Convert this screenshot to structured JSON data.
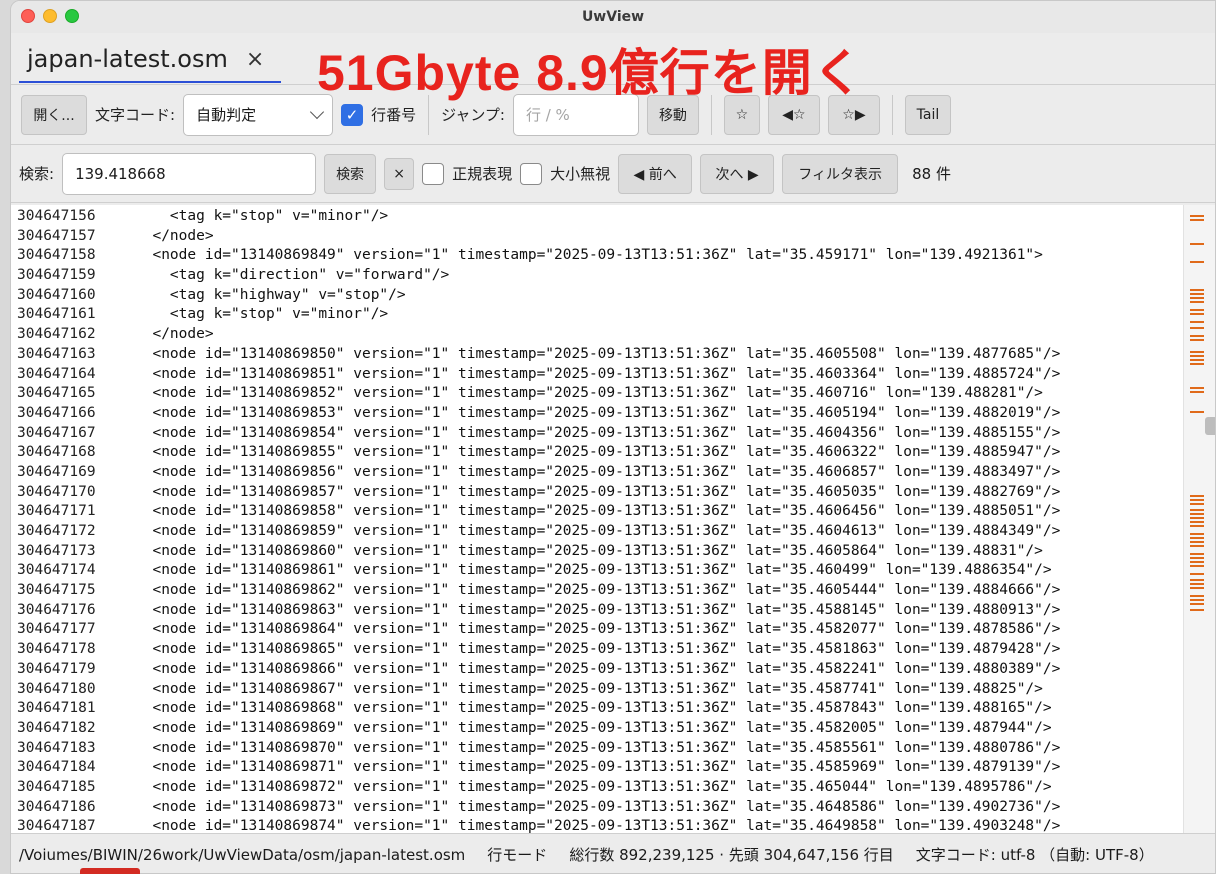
{
  "window": {
    "title": "UwView"
  },
  "tab": {
    "label": "japan-latest.osm",
    "close": "×"
  },
  "banner": "51Gbyte 8.9億行を開く",
  "toolbar": {
    "open_label": "開く...",
    "encoding_label": "文字コード:",
    "encoding_value": "自動判定",
    "line_numbers_label": "行番号",
    "line_numbers_checked": true,
    "jump_label": "ジャンプ:",
    "jump_placeholder": "行 / %",
    "move_label": "移動",
    "star_label": "☆",
    "prev_star_label": "◀☆",
    "next_star_label": "☆▶",
    "tail_label": "Tail"
  },
  "search": {
    "label": "検索:",
    "value": "139.418668",
    "search_button": "検索",
    "clear_button": "×",
    "regex_label": "正規表現",
    "regex_checked": false,
    "ignore_case_label": "大小無視",
    "ignore_case_checked": false,
    "prev_label": "◀ 前へ",
    "next_label": "次へ ▶",
    "filter_label": "フィルタ表示",
    "result_count": "88 件"
  },
  "lines": [
    {
      "no": "304647156",
      "text": "    <tag k=\"stop\" v=\"minor\"/>"
    },
    {
      "no": "304647157",
      "text": "  </node>"
    },
    {
      "no": "304647158",
      "text": "  <node id=\"13140869849\" version=\"1\" timestamp=\"2025-09-13T13:51:36Z\" lat=\"35.459171\" lon=\"139.4921361\">"
    },
    {
      "no": "304647159",
      "text": "    <tag k=\"direction\" v=\"forward\"/>"
    },
    {
      "no": "304647160",
      "text": "    <tag k=\"highway\" v=\"stop\"/>"
    },
    {
      "no": "304647161",
      "text": "    <tag k=\"stop\" v=\"minor\"/>"
    },
    {
      "no": "304647162",
      "text": "  </node>"
    },
    {
      "no": "304647163",
      "text": "  <node id=\"13140869850\" version=\"1\" timestamp=\"2025-09-13T13:51:36Z\" lat=\"35.4605508\" lon=\"139.4877685\"/>"
    },
    {
      "no": "304647164",
      "text": "  <node id=\"13140869851\" version=\"1\" timestamp=\"2025-09-13T13:51:36Z\" lat=\"35.4603364\" lon=\"139.4885724\"/>"
    },
    {
      "no": "304647165",
      "text": "  <node id=\"13140869852\" version=\"1\" timestamp=\"2025-09-13T13:51:36Z\" lat=\"35.460716\" lon=\"139.488281\"/>"
    },
    {
      "no": "304647166",
      "text": "  <node id=\"13140869853\" version=\"1\" timestamp=\"2025-09-13T13:51:36Z\" lat=\"35.4605194\" lon=\"139.4882019\"/>"
    },
    {
      "no": "304647167",
      "text": "  <node id=\"13140869854\" version=\"1\" timestamp=\"2025-09-13T13:51:36Z\" lat=\"35.4604356\" lon=\"139.4885155\"/>"
    },
    {
      "no": "304647168",
      "text": "  <node id=\"13140869855\" version=\"1\" timestamp=\"2025-09-13T13:51:36Z\" lat=\"35.4606322\" lon=\"139.4885947\"/>"
    },
    {
      "no": "304647169",
      "text": "  <node id=\"13140869856\" version=\"1\" timestamp=\"2025-09-13T13:51:36Z\" lat=\"35.4606857\" lon=\"139.4883497\"/>"
    },
    {
      "no": "304647170",
      "text": "  <node id=\"13140869857\" version=\"1\" timestamp=\"2025-09-13T13:51:36Z\" lat=\"35.4605035\" lon=\"139.4882769\"/>"
    },
    {
      "no": "304647171",
      "text": "  <node id=\"13140869858\" version=\"1\" timestamp=\"2025-09-13T13:51:36Z\" lat=\"35.4606456\" lon=\"139.4885051\"/>"
    },
    {
      "no": "304647172",
      "text": "  <node id=\"13140869859\" version=\"1\" timestamp=\"2025-09-13T13:51:36Z\" lat=\"35.4604613\" lon=\"139.4884349\"/>"
    },
    {
      "no": "304647173",
      "text": "  <node id=\"13140869860\" version=\"1\" timestamp=\"2025-09-13T13:51:36Z\" lat=\"35.4605864\" lon=\"139.48831\"/>"
    },
    {
      "no": "304647174",
      "text": "  <node id=\"13140869861\" version=\"1\" timestamp=\"2025-09-13T13:51:36Z\" lat=\"35.460499\" lon=\"139.4886354\"/>"
    },
    {
      "no": "304647175",
      "text": "  <node id=\"13140869862\" version=\"1\" timestamp=\"2025-09-13T13:51:36Z\" lat=\"35.4605444\" lon=\"139.4884666\"/>"
    },
    {
      "no": "304647176",
      "text": "  <node id=\"13140869863\" version=\"1\" timestamp=\"2025-09-13T13:51:36Z\" lat=\"35.4588145\" lon=\"139.4880913\"/>"
    },
    {
      "no": "304647177",
      "text": "  <node id=\"13140869864\" version=\"1\" timestamp=\"2025-09-13T13:51:36Z\" lat=\"35.4582077\" lon=\"139.4878586\"/>"
    },
    {
      "no": "304647178",
      "text": "  <node id=\"13140869865\" version=\"1\" timestamp=\"2025-09-13T13:51:36Z\" lat=\"35.4581863\" lon=\"139.4879428\"/>"
    },
    {
      "no": "304647179",
      "text": "  <node id=\"13140869866\" version=\"1\" timestamp=\"2025-09-13T13:51:36Z\" lat=\"35.4582241\" lon=\"139.4880389\"/>"
    },
    {
      "no": "304647180",
      "text": "  <node id=\"13140869867\" version=\"1\" timestamp=\"2025-09-13T13:51:36Z\" lat=\"35.4587741\" lon=\"139.48825\"/>"
    },
    {
      "no": "304647181",
      "text": "  <node id=\"13140869868\" version=\"1\" timestamp=\"2025-09-13T13:51:36Z\" lat=\"35.4587843\" lon=\"139.488165\"/>"
    },
    {
      "no": "304647182",
      "text": "  <node id=\"13140869869\" version=\"1\" timestamp=\"2025-09-13T13:51:36Z\" lat=\"35.4582005\" lon=\"139.487944\"/>"
    },
    {
      "no": "304647183",
      "text": "  <node id=\"13140869870\" version=\"1\" timestamp=\"2025-09-13T13:51:36Z\" lat=\"35.4585561\" lon=\"139.4880786\"/>"
    },
    {
      "no": "304647184",
      "text": "  <node id=\"13140869871\" version=\"1\" timestamp=\"2025-09-13T13:51:36Z\" lat=\"35.4585969\" lon=\"139.4879139\"/>"
    },
    {
      "no": "304647185",
      "text": "  <node id=\"13140869872\" version=\"1\" timestamp=\"2025-09-13T13:51:36Z\" lat=\"35.465044\" lon=\"139.4895786\"/>"
    },
    {
      "no": "304647186",
      "text": "  <node id=\"13140869873\" version=\"1\" timestamp=\"2025-09-13T13:51:36Z\" lat=\"35.4648586\" lon=\"139.4902736\"/>"
    },
    {
      "no": "304647187",
      "text": "  <node id=\"13140869874\" version=\"1\" timestamp=\"2025-09-13T13:51:36Z\" lat=\"35.4649858\" lon=\"139.4903248\"/>"
    }
  ],
  "status": {
    "path": "/Voiumes/BIWIN/26work/UwViewData/osm/japan-latest.osm",
    "mode": "行モード",
    "summary": "総行数 892,239,125 · 先頭 304,647,156 行目",
    "encoding": "文字コード: utf-8 （自動: UTF-8）"
  },
  "colors": {
    "accent": "#2f6fe4",
    "banner": "#e8231e",
    "match_marker": "#e06a1a"
  }
}
